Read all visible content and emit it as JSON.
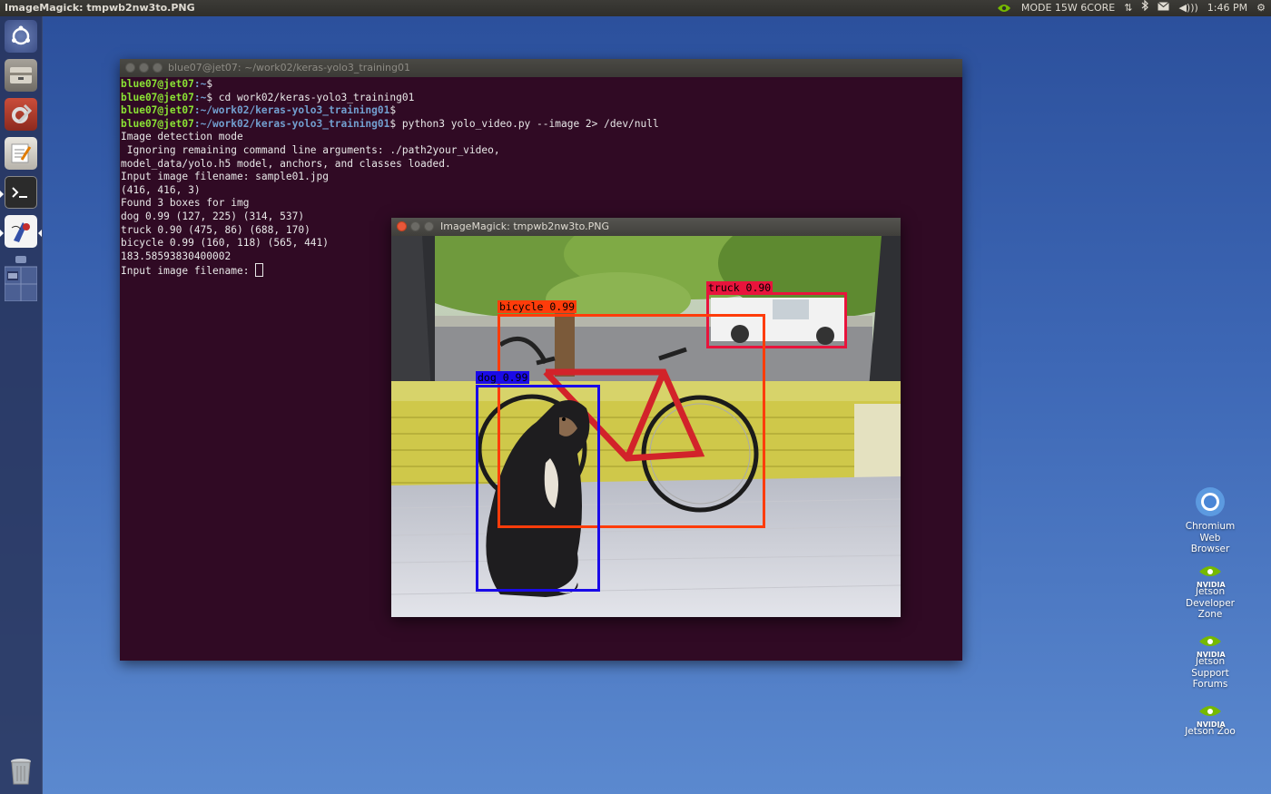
{
  "top_panel": {
    "window_title": "ImageMagick: tmpwb2nw3to.PNG",
    "mode_text": "MODE 15W 6CORE",
    "clock": "1:46 PM",
    "icons": [
      "nvidia-icon",
      "network-arrows-icon",
      "bluetooth-icon",
      "mail-icon",
      "volume-icon",
      "settings-gear-icon"
    ]
  },
  "launcher": {
    "items": [
      {
        "name": "dash-icon"
      },
      {
        "name": "files-icon"
      },
      {
        "name": "system-settings-icon"
      },
      {
        "name": "text-editor-icon"
      },
      {
        "name": "terminal-icon"
      },
      {
        "name": "imagemagick-icon"
      },
      {
        "name": "workspace-switcher-icon"
      },
      {
        "name": "trash-icon"
      }
    ]
  },
  "terminal": {
    "title": "blue07@jet07: ~/work02/keras-yolo3_training01",
    "lines": [
      {
        "user": "blue07@jet07",
        "path": ":~",
        "cmd": "$"
      },
      {
        "user": "blue07@jet07",
        "path": ":~",
        "cmd": "$ cd work02/keras-yolo3_training01"
      },
      {
        "user": "blue07@jet07",
        "path": ":~/work02/keras-yolo3_training01",
        "cmd": "$"
      },
      {
        "user": "blue07@jet07",
        "path": ":~/work02/keras-yolo3_training01",
        "cmd": "$ python3 yolo_video.py --image 2> /dev/null"
      }
    ],
    "output": [
      "Image detection mode",
      " Ignoring remaining command line arguments: ./path2your_video,",
      "model_data/yolo.h5 model, anchors, and classes loaded.",
      "Input image filename: sample01.jpg",
      "(416, 416, 3)",
      "Found 3 boxes for img",
      "dog 0.99 (127, 225) (314, 537)",
      "truck 0.90 (475, 86) (688, 170)",
      "bicycle 0.99 (160, 118) (565, 441)",
      "183.58593830400002"
    ],
    "prompt": "Input image filename: "
  },
  "image_window": {
    "title": "ImageMagick: tmpwb2nw3to.PNG",
    "detections": [
      {
        "label": "truck 0.90",
        "color": "#e8143c"
      },
      {
        "label": "bicycle 0.99",
        "color": "#ff3c0a"
      },
      {
        "label": "dog 0.99",
        "color": "#1a0ae8"
      }
    ]
  },
  "desktop_icons": [
    {
      "name": "chromium-icon",
      "label_lines": [
        "Chromium",
        "Web",
        "Browser"
      ]
    },
    {
      "name": "jetson-developer-zone-icon",
      "label_lines": [
        "Jetson",
        "Developer",
        "Zone"
      ]
    },
    {
      "name": "jetson-support-forums-icon",
      "label_lines": [
        "Jetson",
        "Support",
        "Forums"
      ]
    },
    {
      "name": "jetson-zoo-icon",
      "label_lines": [
        "Jetson Zoo"
      ]
    }
  ],
  "nvidia_wordmark": "NVIDIA",
  "colors": {
    "terminal_bg": "#300a24",
    "prompt_user": "#8ae234",
    "prompt_path": "#729fcf",
    "nvidia_green": "#76b900"
  }
}
